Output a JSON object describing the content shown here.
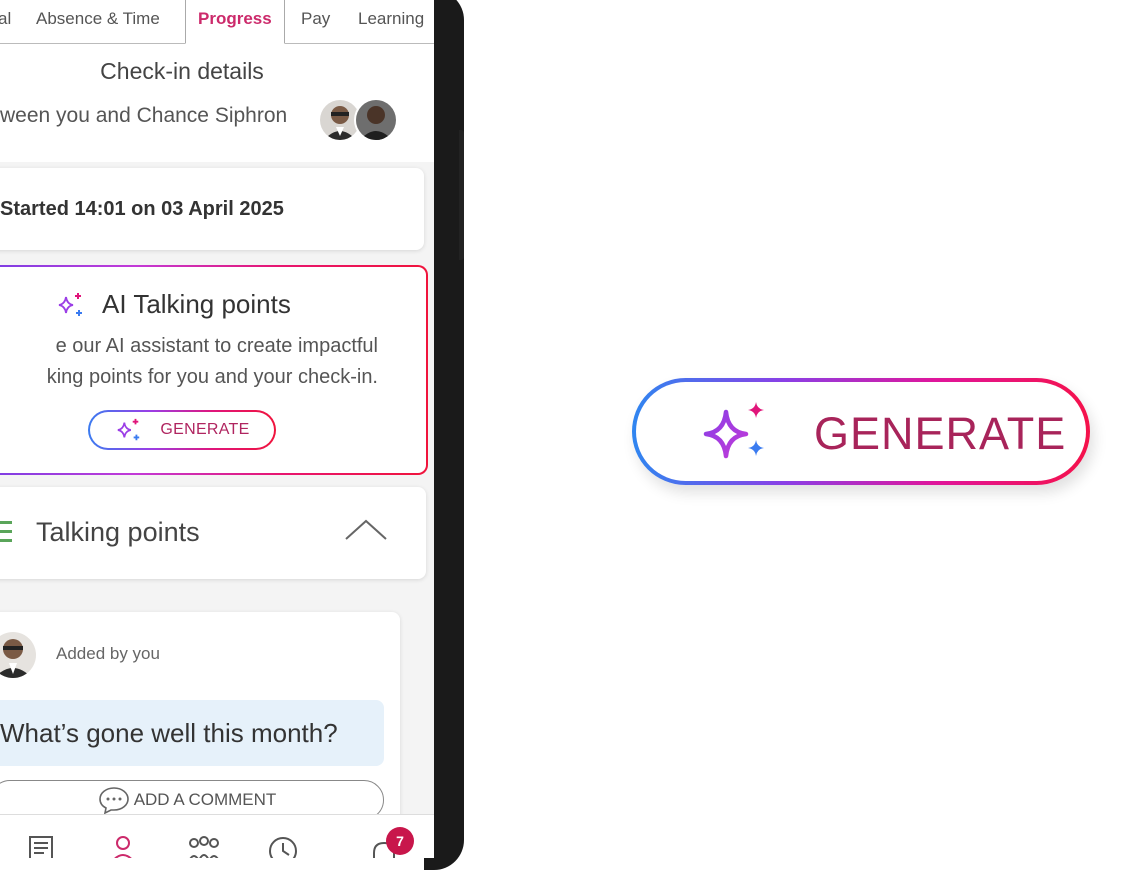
{
  "tabs": [
    {
      "label": "al"
    },
    {
      "label": "Absence & Time"
    },
    {
      "label": "Progress"
    },
    {
      "label": "Pay"
    },
    {
      "label": "Learning"
    }
  ],
  "checkin": {
    "title": "Check-in details",
    "between_text": "ween you and Chance Siphron",
    "started_text": "Started 14:01 on 03 April 2025"
  },
  "ai_card": {
    "title": "AI Talking points",
    "desc_line1": "e our AI assistant to create impactful",
    "desc_line2": "king points for you and your check-in.",
    "generate_label": "GENERATE"
  },
  "talking_points": {
    "title": "Talking points",
    "added_by": "Added by you",
    "question": "What’s gone well this month?",
    "add_comment_label": "ADD A COMMENT"
  },
  "bottom_nav": {
    "items": [
      "news-icon",
      "profile-icon",
      "team-icon",
      "clock-icon",
      "bell-icon"
    ],
    "notification_count": "7"
  },
  "promo": {
    "generate_label": "GENERATE"
  },
  "colors": {
    "accent_pink": "#cc2a6b",
    "gradient_start": "#2f86f0",
    "gradient_end": "#f5124a",
    "badge": "#c8164b"
  }
}
